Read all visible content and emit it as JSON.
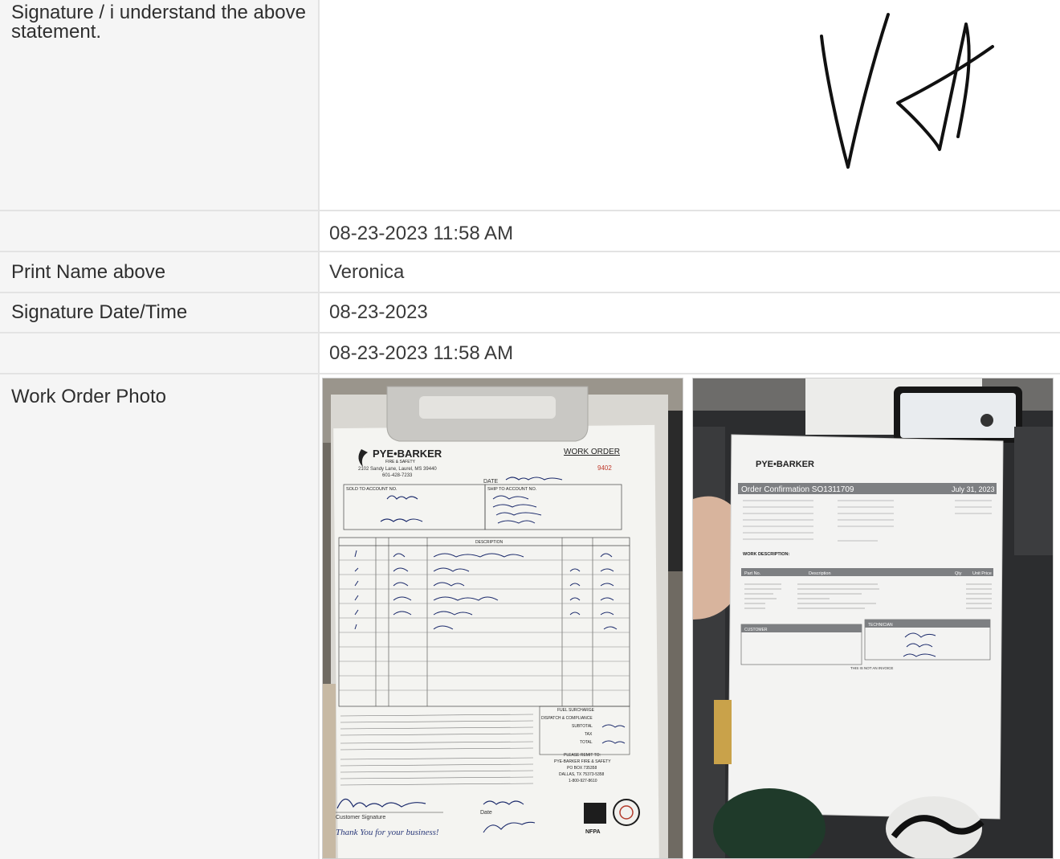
{
  "rows": {
    "signature": {
      "label": "Signature / i understand the above statement."
    },
    "signature_timestamp": {
      "label": "",
      "value": "08-23-2023 11:58 AM"
    },
    "print_name": {
      "label": "Print Name above",
      "value": "Veronica"
    },
    "signature_date": {
      "label": "Signature Date/Time",
      "value": "08-23-2023"
    },
    "signature_date_timestamp": {
      "label": "",
      "value": "08-23-2023 11:58 AM"
    },
    "work_order_photo": {
      "label": "Work Order Photo"
    }
  },
  "photo1": {
    "brand": "PYE•BARKER",
    "brand_sub": "FIRE & SAFETY",
    "address": "2102 Sandy Lane, Laurel, MS 39440",
    "phone": "601-428-7233",
    "doc_title": "WORK ORDER",
    "doc_number": "9402",
    "sold_to": "SOLD TO ACCOUNT NO.",
    "ship_to": "SHIP TO ACCOUNT NO.",
    "date_label": "DATE",
    "description": "DESCRIPTION",
    "subtotal": "SUBTOTAL",
    "total": "TOTAL",
    "tax": "TAX",
    "fuel": "FUEL SURCHARGE",
    "dispatch": "DISPATCH & COMPLIANCE",
    "remit_title": "PLEASE REMIT TO:",
    "remit_name": "PYE-BARKER FIRE & SAFETY",
    "remit_box": "PO BOX 735358",
    "remit_city": "DALLAS, TX 75373-5358",
    "remit_phone": "1-800-927-8610",
    "customer_signature": "Customer Signature",
    "date_word": "Date",
    "thanks": "Thank You for your business!",
    "nfpa": "NFPA"
  },
  "photo2": {
    "brand": "PYE•BARKER",
    "title": "Order Confirmation SO1311709",
    "date": "July 31, 2023",
    "work_desc": "WORK DESCRIPTION:",
    "part_no": "Part No.",
    "desc_col": "Description",
    "qty": "Qty",
    "unit_price": "Unit Price",
    "customer": "CUSTOMER",
    "technician": "TECHNICIAN",
    "not_invoice": "THIS IS NOT AN INVOICE"
  },
  "colors": {
    "label_bg": "#f5f5f5",
    "border": "#e3e3e3",
    "ink": "#111111"
  }
}
